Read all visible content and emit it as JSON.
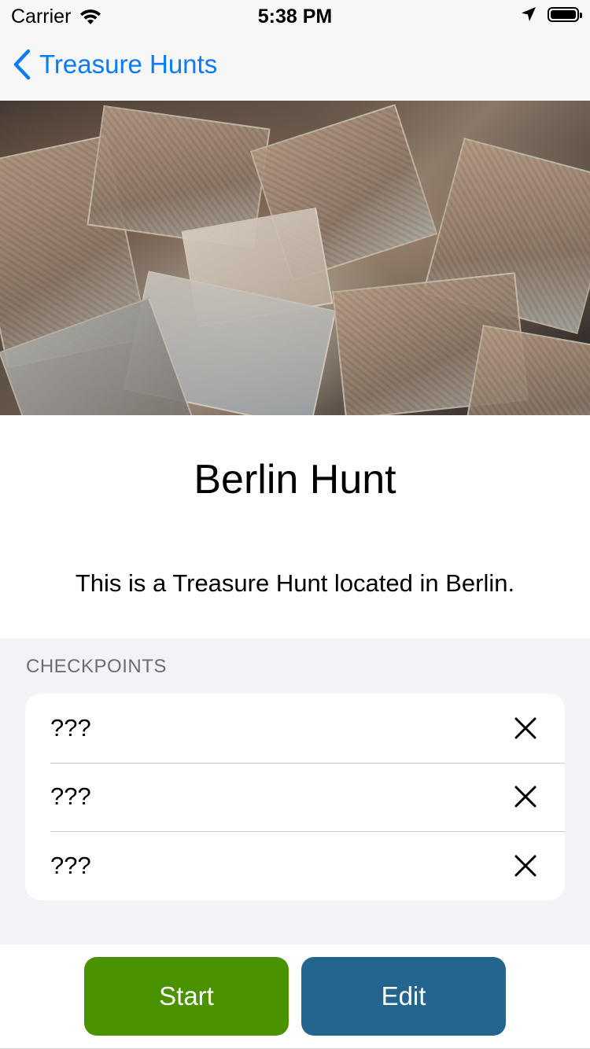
{
  "status_bar": {
    "carrier": "Carrier",
    "time": "5:38 PM"
  },
  "nav": {
    "back_label": "Treasure Hunts"
  },
  "hunt": {
    "title": "Berlin Hunt",
    "description": "This is a Treasure Hunt located in Berlin."
  },
  "checkpoints": {
    "header": "CHECKPOINTS",
    "items": [
      {
        "label": "???"
      },
      {
        "label": "???"
      },
      {
        "label": "???"
      }
    ]
  },
  "actions": {
    "start_label": "Start",
    "edit_label": "Edit"
  },
  "colors": {
    "accent": "#0a7aff",
    "start_button": "#4a9200",
    "edit_button": "#246590"
  },
  "icons": {
    "wifi": "wifi-icon",
    "location": "location-arrow-icon",
    "battery": "battery-icon",
    "back": "chevron-left-icon",
    "delete": "close-icon"
  }
}
